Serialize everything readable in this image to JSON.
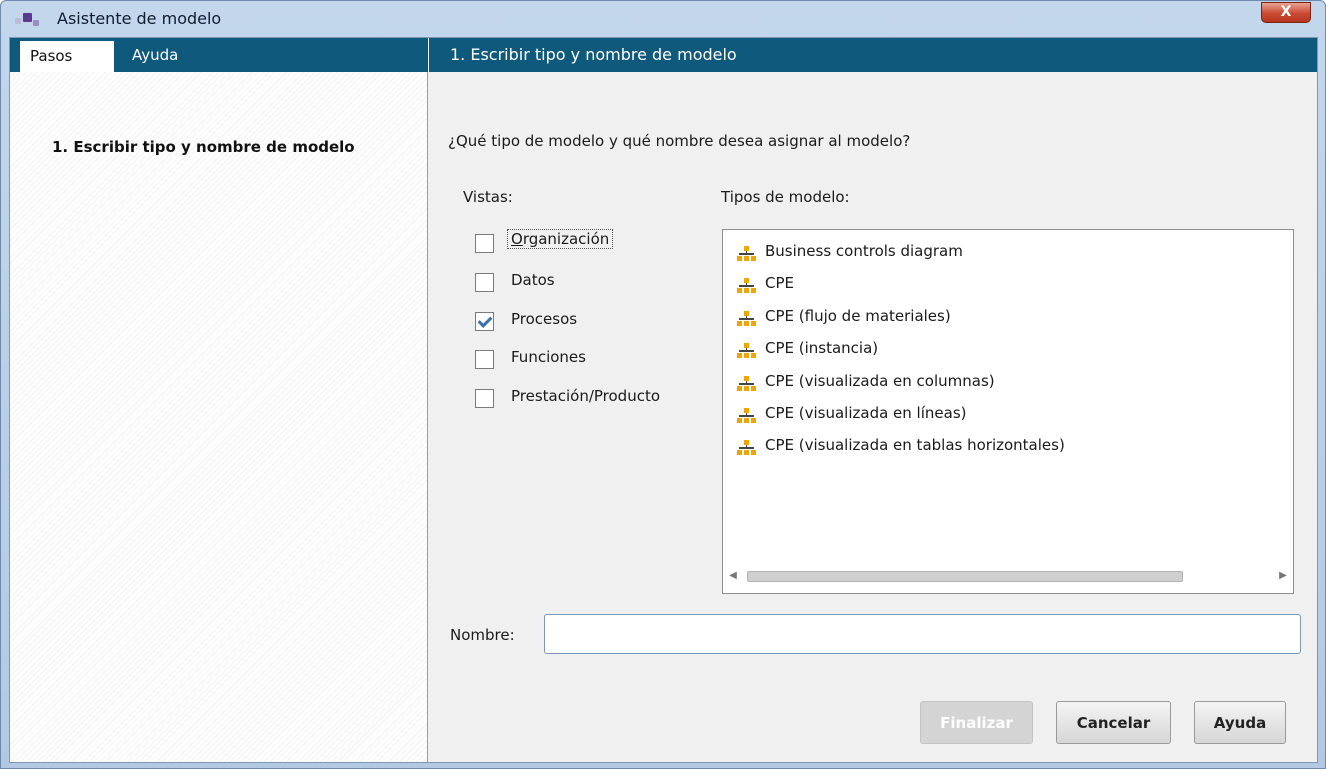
{
  "window": {
    "title": "Asistente de modelo",
    "close_label": "X"
  },
  "left": {
    "tabs": [
      {
        "label": "Pasos",
        "active": true
      },
      {
        "label": "Ayuda",
        "active": false
      }
    ],
    "steps": [
      "1. Escribir tipo y nombre de modelo"
    ]
  },
  "right": {
    "header": "1. Escribir tipo y nombre de modelo",
    "question": "¿Qué tipo de modelo y qué nombre desea asignar al modelo?",
    "views_label": "Vistas:",
    "types_label": "Tipos de modelo:",
    "views": [
      {
        "label": "Organización",
        "checked": false
      },
      {
        "label": "Datos",
        "checked": false
      },
      {
        "label": "Procesos",
        "checked": true
      },
      {
        "label": "Funciones",
        "checked": false
      },
      {
        "label": "Prestación/Producto",
        "checked": false
      }
    ],
    "model_types": [
      "Business controls diagram",
      "CPE",
      "CPE (flujo de materiales)",
      "CPE (instancia)",
      "CPE (visualizada en columnas)",
      "CPE (visualizada en líneas)",
      "CPE (visualizada en tablas horizontales)"
    ],
    "model_type_icon": "hierarchy-icon",
    "name_label": "Nombre:",
    "name_value": ""
  },
  "buttons": {
    "finish": "Finalizar",
    "cancel": "Cancelar",
    "help": "Ayuda"
  },
  "colors": {
    "header_bg": "#0f5a7c",
    "icon_accent": "#f0a500",
    "close_red": "#c94a31"
  }
}
